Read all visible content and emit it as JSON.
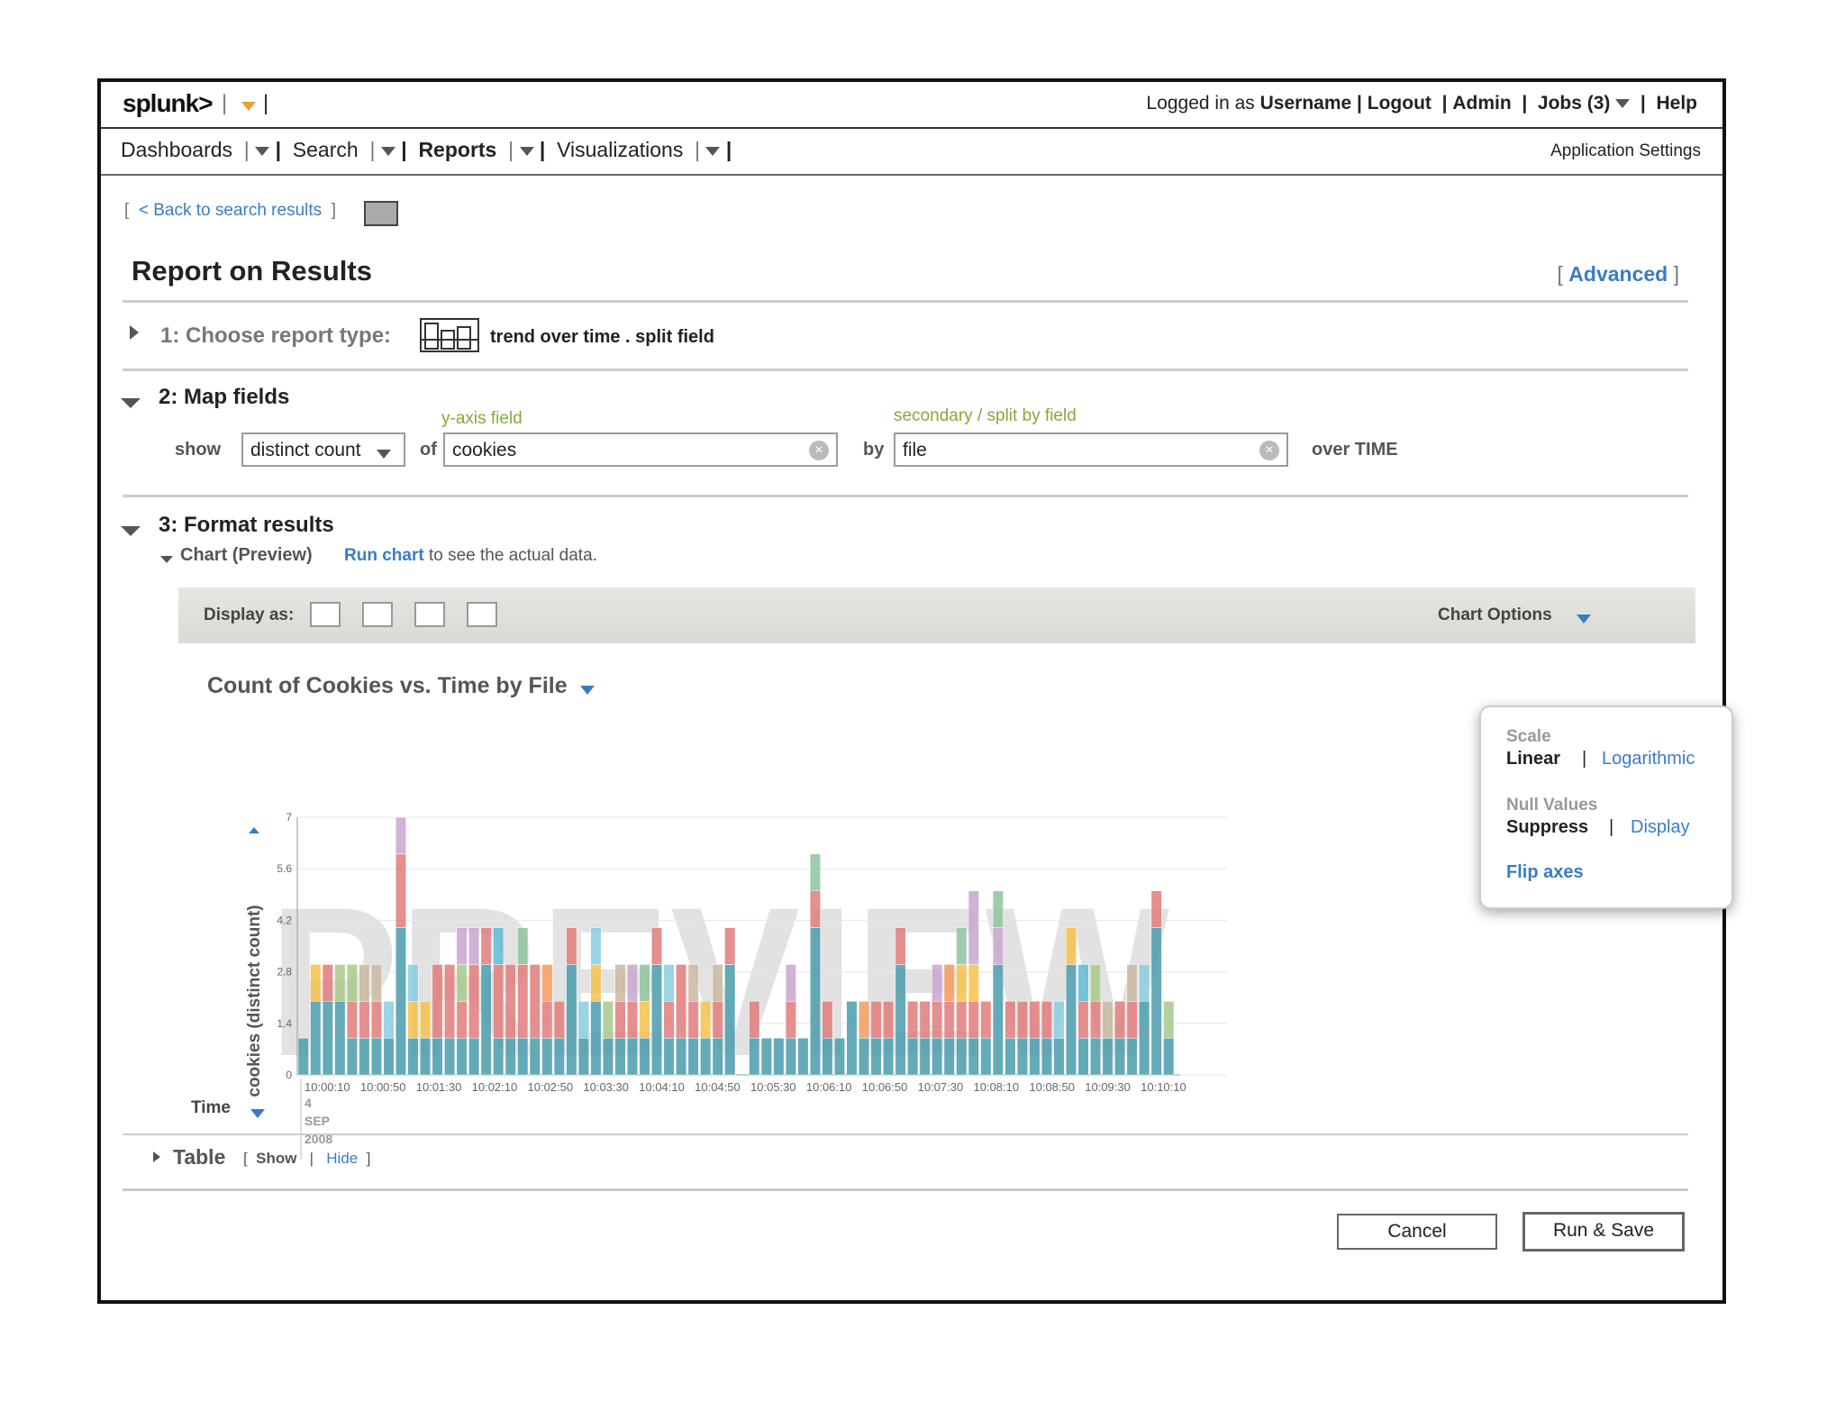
{
  "header": {
    "logo": "splunk>",
    "logged_in_prefix": "Logged in as",
    "username": "Username",
    "logout": "Logout",
    "admin": "Admin",
    "jobs": "Jobs (3)",
    "help": "Help"
  },
  "nav": {
    "items": [
      "Dashboards",
      "Search",
      "Reports",
      "Visualizations"
    ],
    "app_settings": "Application Settings"
  },
  "breadcrumb": {
    "back": "Back to search results"
  },
  "page": {
    "title": "Report on Results",
    "advanced": "Advanced"
  },
  "step1": {
    "label": "1: Choose report type:",
    "value": "trend over time . split field"
  },
  "step2": {
    "label": "2: Map fields",
    "show_label": "show",
    "show_value": "distinct count",
    "of_label": "of",
    "yaxis_caption": "y-axis field",
    "yaxis_value": "cookies",
    "by_label": "by",
    "split_caption": "secondary / split by field",
    "split_value": "file",
    "over_label": "over TIME"
  },
  "step3": {
    "label": "3: Format results",
    "chart_section": "Chart (Preview)",
    "run_chart": "Run chart",
    "run_chart_suffix": "to see the actual data.",
    "display_as": "Display as:",
    "chart_options": "Chart Options",
    "table_label": "Table",
    "table_show": "Show",
    "table_hide": "Hide"
  },
  "chart_options_popup": {
    "scale_label": "Scale",
    "scale_linear": "Linear",
    "scale_log": "Logarithmic",
    "null_label": "Null Values",
    "null_suppress": "Suppress",
    "null_display": "Display",
    "flip_axes": "Flip axes"
  },
  "buttons": {
    "cancel": "Cancel",
    "run_save": "Run & Save"
  },
  "colors": {
    "link": "#3a7cc4",
    "caption_green": "#86a83f",
    "accent_orange": "#e8a03a"
  },
  "chart_data": {
    "type": "bar",
    "stacked": true,
    "title": "Count of Cookies vs. Time by File",
    "watermark": "PREVIEW",
    "ylabel": "cookies (distinct count)",
    "xlabel": "Time",
    "ylim": [
      0,
      7
    ],
    "yticks": [
      "0",
      "1.4",
      "2.8",
      "4.2",
      "5.6",
      "7"
    ],
    "xticks": [
      "10:00:10",
      "10:00:50",
      "10:01:30",
      "10:02:10",
      "10:02:50",
      "10:03:30",
      "10:04:10",
      "10:04:50",
      "10:05:30",
      "10:06:10",
      "10:06:50",
      "10:07:30",
      "10:08:10",
      "10:08:50",
      "10:09:30",
      "10:10:10"
    ],
    "x_sublabels": [
      "4",
      "SEP",
      "2008"
    ],
    "series_colors": [
      "#4a9bab",
      "#e07b7b",
      "#a8c98a",
      "#f4c24a",
      "#f59a5a",
      "#c8a6cf",
      "#8fc3a0",
      "#89cce0",
      "#c9b9a0",
      "#5fb8d0"
    ],
    "bars": [
      [
        1,
        0,
        0,
        0,
        0,
        0,
        0,
        0,
        0,
        0
      ],
      [
        2,
        0,
        0,
        1,
        0,
        0,
        0,
        0,
        0,
        0
      ],
      [
        2,
        1,
        0,
        0,
        0,
        0,
        0,
        0,
        0,
        0
      ],
      [
        2,
        0,
        1,
        0,
        0,
        0,
        0,
        0,
        0,
        0
      ],
      [
        1,
        1,
        1,
        0,
        0,
        0,
        0,
        0,
        0,
        0
      ],
      [
        1,
        1,
        0,
        0,
        0,
        0,
        0,
        0,
        1,
        0
      ],
      [
        1,
        1,
        0,
        0,
        0,
        0,
        0,
        0,
        1,
        0
      ],
      [
        1,
        0,
        0,
        0,
        0,
        0,
        0,
        1,
        0,
        0
      ],
      [
        4,
        2,
        0,
        0,
        0,
        1,
        0,
        0,
        0,
        0
      ],
      [
        1,
        0,
        0,
        1,
        0,
        0,
        0,
        1,
        0,
        0
      ],
      [
        1,
        0,
        0,
        1,
        0,
        0,
        0,
        0,
        0,
        0
      ],
      [
        1,
        2,
        0,
        0,
        0,
        0,
        0,
        0,
        0,
        0
      ],
      [
        1,
        2,
        0,
        0,
        0,
        0,
        0,
        0,
        0,
        0
      ],
      [
        1,
        1,
        1,
        0,
        0,
        1,
        0,
        0,
        0,
        0
      ],
      [
        1,
        2,
        0,
        0,
        0,
        1,
        0,
        0,
        0,
        0
      ],
      [
        3,
        1,
        0,
        0,
        0,
        0,
        0,
        0,
        0,
        0
      ],
      [
        1,
        2,
        0,
        0,
        0,
        0,
        0,
        0,
        0,
        1
      ],
      [
        1,
        2,
        0,
        0,
        0,
        0,
        0,
        0,
        0,
        0
      ],
      [
        1,
        2,
        0,
        0,
        0,
        0,
        1,
        0,
        0,
        0
      ],
      [
        1,
        2,
        0,
        0,
        0,
        0,
        0,
        0,
        0,
        0
      ],
      [
        1,
        1,
        0,
        0,
        1,
        0,
        0,
        0,
        0,
        0
      ],
      [
        1,
        1,
        0,
        0,
        0,
        0,
        0,
        0,
        0,
        0
      ],
      [
        3,
        1,
        0,
        0,
        0,
        0,
        0,
        0,
        0,
        0
      ],
      [
        1,
        0,
        0,
        0,
        0,
        0,
        0,
        1,
        0,
        0
      ],
      [
        2,
        0,
        0,
        1,
        0,
        0,
        0,
        1,
        0,
        0
      ],
      [
        1,
        0,
        1,
        0,
        0,
        0,
        0,
        0,
        0,
        0
      ],
      [
        1,
        1,
        0,
        0,
        0,
        0,
        0,
        0,
        1,
        0
      ],
      [
        1,
        1,
        0,
        0,
        0,
        1,
        0,
        0,
        0,
        0
      ],
      [
        1,
        0,
        0,
        1,
        0,
        0,
        1,
        0,
        0,
        0
      ],
      [
        3,
        1,
        0,
        0,
        0,
        0,
        0,
        0,
        0,
        0
      ],
      [
        1,
        1,
        0,
        0,
        0,
        0,
        0,
        1,
        0,
        0
      ],
      [
        1,
        2,
        0,
        0,
        0,
        0,
        0,
        0,
        0,
        0
      ],
      [
        1,
        1,
        0,
        0,
        0,
        0,
        0,
        0,
        1,
        0
      ],
      [
        1,
        0,
        0,
        1,
        0,
        0,
        0,
        0,
        0,
        0
      ],
      [
        1,
        1,
        0,
        0,
        0,
        0,
        0,
        0,
        1,
        0
      ],
      [
        3,
        1,
        0,
        0,
        0,
        0,
        0,
        0,
        0,
        0
      ],
      [
        0,
        0,
        0,
        0,
        0,
        0,
        0,
        0,
        0,
        0
      ],
      [
        1,
        1,
        0,
        0,
        0,
        0,
        0,
        0,
        0,
        0
      ],
      [
        1,
        0,
        0,
        0,
        0,
        0,
        0,
        0,
        0,
        0
      ],
      [
        1,
        0,
        0,
        0,
        0,
        0,
        0,
        0,
        0,
        0
      ],
      [
        1,
        1,
        0,
        0,
        0,
        1,
        0,
        0,
        0,
        0
      ],
      [
        1,
        0,
        0,
        0,
        0,
        0,
        0,
        0,
        0,
        0
      ],
      [
        4,
        1,
        0,
        0,
        0,
        0,
        1,
        0,
        0,
        0
      ],
      [
        1,
        1,
        0,
        0,
        0,
        0,
        0,
        0,
        0,
        0
      ],
      [
        1,
        0,
        0,
        0,
        0,
        0,
        0,
        0,
        0,
        0
      ],
      [
        2,
        0,
        0,
        0,
        0,
        0,
        0,
        0,
        0,
        0
      ],
      [
        1,
        0,
        0,
        0,
        1,
        0,
        0,
        0,
        0,
        0
      ],
      [
        1,
        1,
        0,
        0,
        0,
        0,
        0,
        0,
        0,
        0
      ],
      [
        1,
        1,
        0,
        0,
        0,
        0,
        0,
        0,
        0,
        0
      ],
      [
        3,
        1,
        0,
        0,
        0,
        0,
        0,
        0,
        0,
        0
      ],
      [
        1,
        1,
        0,
        0,
        0,
        0,
        0,
        0,
        0,
        0
      ],
      [
        1,
        1,
        0,
        0,
        0,
        0,
        0,
        0,
        0,
        0
      ],
      [
        1,
        1,
        0,
        0,
        0,
        1,
        0,
        0,
        0,
        0
      ],
      [
        1,
        1,
        0,
        0,
        1,
        0,
        0,
        0,
        0,
        0
      ],
      [
        1,
        1,
        0,
        1,
        0,
        0,
        1,
        0,
        0,
        0
      ],
      [
        1,
        1,
        0,
        1,
        0,
        2,
        0,
        0,
        0,
        0
      ],
      [
        1,
        1,
        0,
        0,
        0,
        0,
        0,
        0,
        0,
        0
      ],
      [
        3,
        0,
        0,
        0,
        0,
        1,
        1,
        0,
        0,
        0
      ],
      [
        1,
        1,
        0,
        0,
        0,
        0,
        0,
        0,
        0,
        0
      ],
      [
        1,
        1,
        0,
        0,
        0,
        0,
        0,
        0,
        0,
        0
      ],
      [
        1,
        1,
        0,
        0,
        0,
        0,
        0,
        0,
        0,
        0
      ],
      [
        1,
        1,
        0,
        0,
        0,
        0,
        0,
        0,
        0,
        0
      ],
      [
        1,
        0,
        0,
        0,
        0,
        0,
        0,
        1,
        0,
        0
      ],
      [
        3,
        0,
        0,
        1,
        0,
        0,
        0,
        0,
        0,
        0
      ],
      [
        1,
        1,
        0,
        0,
        0,
        0,
        0,
        0,
        0,
        1
      ],
      [
        1,
        1,
        1,
        0,
        0,
        0,
        0,
        0,
        0,
        0
      ],
      [
        1,
        0,
        0,
        0,
        0,
        0,
        0,
        0,
        1,
        0
      ],
      [
        1,
        1,
        0,
        0,
        0,
        0,
        0,
        0,
        0,
        0
      ],
      [
        1,
        1,
        0,
        0,
        0,
        0,
        0,
        0,
        1,
        0
      ],
      [
        2,
        0,
        0,
        0,
        0,
        0,
        0,
        1,
        0,
        0
      ],
      [
        4,
        1,
        0,
        0,
        0,
        0,
        0,
        0,
        0,
        0
      ],
      [
        1,
        0,
        1,
        0,
        0,
        0,
        0,
        0,
        0,
        0
      ]
    ]
  }
}
